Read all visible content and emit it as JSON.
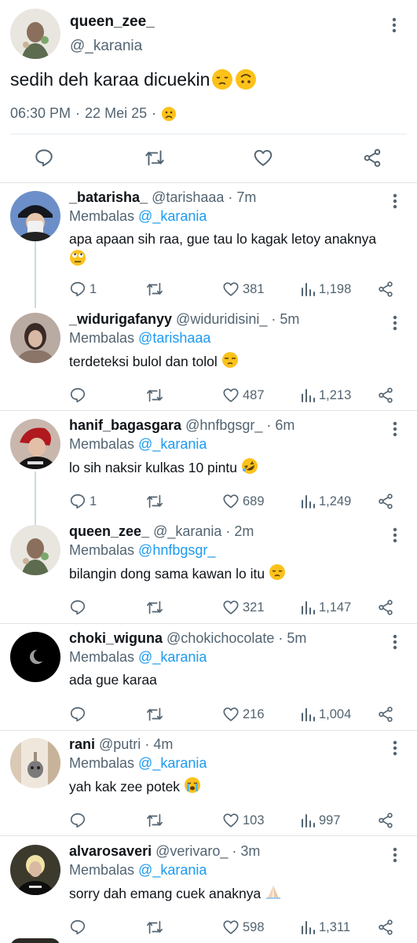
{
  "colors": {
    "link": "#1d9bf0",
    "muted": "#536471",
    "text": "#0f1419",
    "divider": "#e6ecf0"
  },
  "main_tweet": {
    "display_name": "queen_zee_",
    "handle": "@_karania",
    "text": "sedih deh karaa dicuekin",
    "emojis": [
      "pensive-emoji",
      "upside-down-emoji"
    ],
    "time": "06:30 PM",
    "date": "22 Mei 25",
    "dot": "·",
    "meta_emoji": "frowning-emoji",
    "actions": [
      "reply-icon",
      "retweet-icon",
      "like-icon",
      "share-icon"
    ]
  },
  "replies": [
    {
      "name": "_batarisha_",
      "handle": "@tarishaaa",
      "dot": "·",
      "time": "7m",
      "replying_prefix": "Membalas",
      "replying_to": "@_karania",
      "text": "apa apaan sih raa, gue tau lo kagak letoy anaknya",
      "emoji": "rolling-eyes-emoji",
      "replies": "1",
      "retweets": "",
      "likes": "381",
      "views": "1,198"
    },
    {
      "name": "_widurigafanyy",
      "handle": "@widuridisini_",
      "dot": "·",
      "time": "5m",
      "replying_prefix": "Membalas",
      "replying_to": "@tarishaaa",
      "text": "terdeteksi bulol dan tolol",
      "emoji": "unamused-emoji",
      "replies": "",
      "retweets": "",
      "likes": "487",
      "views": "1,213"
    },
    {
      "name": "hanif_bagasgara",
      "handle": "@hnfbgsgr_",
      "dot": "·",
      "time": "6m",
      "replying_prefix": "Membalas",
      "replying_to": "@_karania",
      "text": "lo sih naksir kulkas 10 pintu",
      "emoji": "rofl-emoji",
      "replies": "1",
      "retweets": "",
      "likes": "689",
      "views": "1,249"
    },
    {
      "name": "queen_zee_",
      "handle": "@_karania",
      "dot": "·",
      "time": "2m",
      "replying_prefix": "Membalas",
      "replying_to": "@hnfbgsgr_",
      "text": "bilangin dong sama kawan lo itu",
      "emoji": "pensive-emoji",
      "replies": "",
      "retweets": "",
      "likes": "321",
      "views": "1,147"
    },
    {
      "name": "choki_wiguna",
      "handle": "@chokichocolate",
      "dot": "·",
      "time": "5m",
      "replying_prefix": "Membalas",
      "replying_to": "@_karania",
      "text": "ada gue karaa",
      "emoji": "",
      "replies": "",
      "retweets": "",
      "likes": "216",
      "views": "1,004"
    },
    {
      "name": "rani",
      "handle": "@putri",
      "dot": "·",
      "time": "4m",
      "replying_prefix": "Membalas",
      "replying_to": "@_karania",
      "text": "yah kak zee potek",
      "emoji": "crying-emoji",
      "replies": "",
      "retweets": "",
      "likes": "103",
      "views": "997"
    },
    {
      "name": "alvarosaveri",
      "handle": "@verivaro_",
      "dot": "·",
      "time": "3m",
      "replying_prefix": "Membalas",
      "replying_to": "@_karania",
      "text": "sorry dah emang cuek anaknya",
      "emoji": "folded-hands-emoji",
      "replies": "",
      "retweets": "",
      "likes": "598",
      "views": "1,311"
    }
  ]
}
